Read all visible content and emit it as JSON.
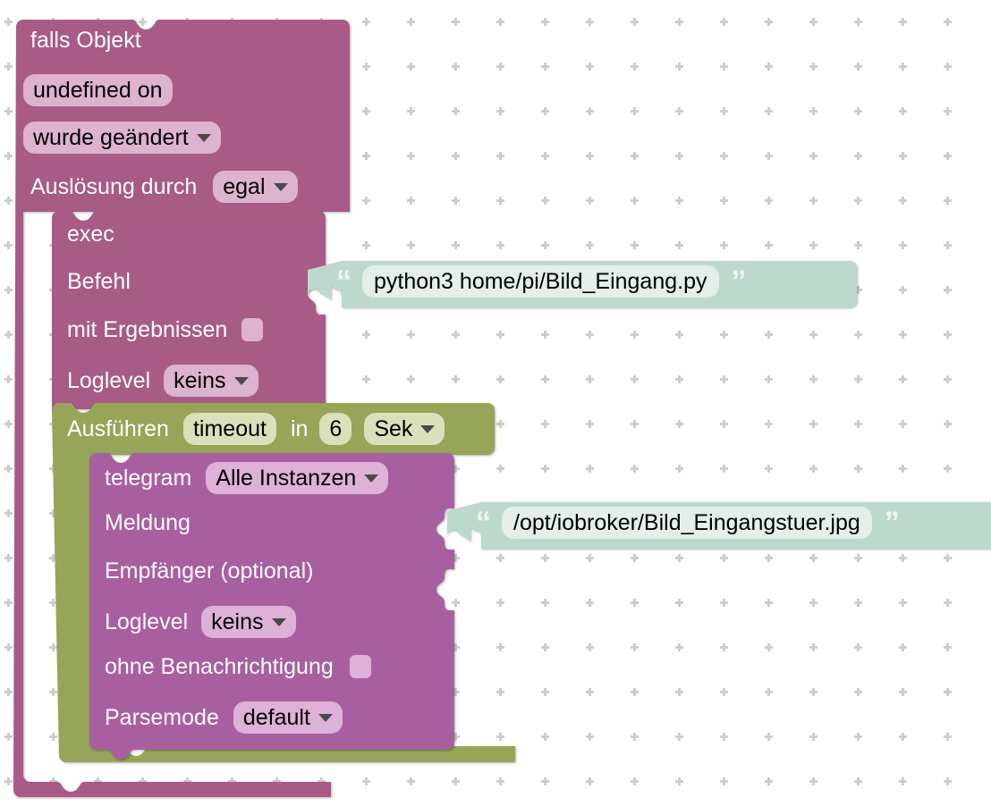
{
  "workspace": {
    "background_color": "#ffffff",
    "grid_color": "#cdcdcd",
    "grid_spacing": 50
  },
  "colors": {
    "trigger_block": "#a85b86",
    "exec_block": "#a85b86",
    "timeout_block": "#96a557",
    "telegram_block": "#a85fa0",
    "text_block": "#bdd9cd",
    "field_light_pink": "#ddb3cf",
    "field_light_violet": "#ddb1d8",
    "field_light_olive": "#dbe0bb",
    "field_text_input": "#e3efe8"
  },
  "blocks": {
    "trigger": {
      "name": "falls Objekt",
      "title": "falls Objekt",
      "object_id": "undefined on",
      "condition": "wurde geändert",
      "trigger_by_label": "Auslösung durch",
      "trigger_by_value": "egal"
    },
    "exec": {
      "title": "exec",
      "command_label": "Befehl",
      "with_results_label": "mit Ergebnissen",
      "with_results_checked": false,
      "loglevel_label": "Loglevel",
      "loglevel_value": "keins",
      "command_value": "python3 home/pi/Bild_Eingang.py"
    },
    "timeout": {
      "run_label": "Ausführen",
      "mode_value": "timeout",
      "in_label": "in",
      "delay_value": "6",
      "unit_value": "Sek"
    },
    "telegram": {
      "title": "telegram",
      "instance_value": "Alle Instanzen",
      "message_label": "Meldung",
      "message_value": "/opt/iobroker/Bild_Eingangstuer.jpg",
      "recipient_label": "Empfänger (optional)",
      "recipient_value": "",
      "loglevel_label": "Loglevel",
      "loglevel_value": "keins",
      "silent_label": "ohne Benachrichtigung",
      "silent_checked": false,
      "parsemode_label": "Parsemode",
      "parsemode_value": "default"
    }
  },
  "icons": {
    "dropdown": "chevron-down-icon",
    "open_quote": "“",
    "close_quote": "”"
  }
}
